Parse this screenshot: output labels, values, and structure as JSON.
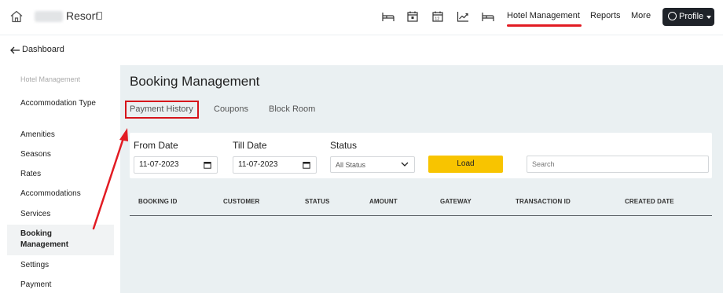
{
  "header": {
    "brand_name": "Resort",
    "nav_icons": [
      "bed-icon",
      "calendar-check-icon",
      "calendar-grid-icon",
      "trend-chart-icon",
      "bed-icon"
    ],
    "nav_links": [
      "Hotel Management",
      "Reports",
      "More"
    ],
    "active_link": "Hotel Management",
    "profile_label": "Profile"
  },
  "back_link": {
    "label": "Dashboard"
  },
  "sidebar": {
    "section_title": "Hotel Management",
    "items": [
      {
        "label": "Accommodation Type"
      },
      {
        "label": "Amenities"
      },
      {
        "label": "Seasons"
      },
      {
        "label": "Rates"
      },
      {
        "label": "Accommodations"
      },
      {
        "label": "Services"
      },
      {
        "label": "Booking Management",
        "active": true
      },
      {
        "label": "Settings"
      },
      {
        "label": "Payment"
      }
    ]
  },
  "main": {
    "title": "Booking Management",
    "tabs": [
      {
        "label": "Payment History",
        "active": true
      },
      {
        "label": "Coupons"
      },
      {
        "label": "Block Room"
      }
    ],
    "filters": {
      "from_date_label": "From Date",
      "from_date_value": "11-07-2023",
      "till_date_label": "Till Date",
      "till_date_value": "11-07-2023",
      "status_label": "Status",
      "status_value": "All Status",
      "load_label": "Load",
      "search_placeholder": "Search"
    },
    "table": {
      "columns": [
        "BOOKING ID",
        "CUSTOMER",
        "STATUS",
        "AMOUNT",
        "GATEWAY",
        "TRANSACTION ID",
        "CREATED DATE"
      ],
      "rows": []
    }
  },
  "colors": {
    "accent_red": "#e21b23",
    "load_button": "#f8c400",
    "content_bg": "#eaf0f2",
    "profile_button": "#1f2329"
  }
}
